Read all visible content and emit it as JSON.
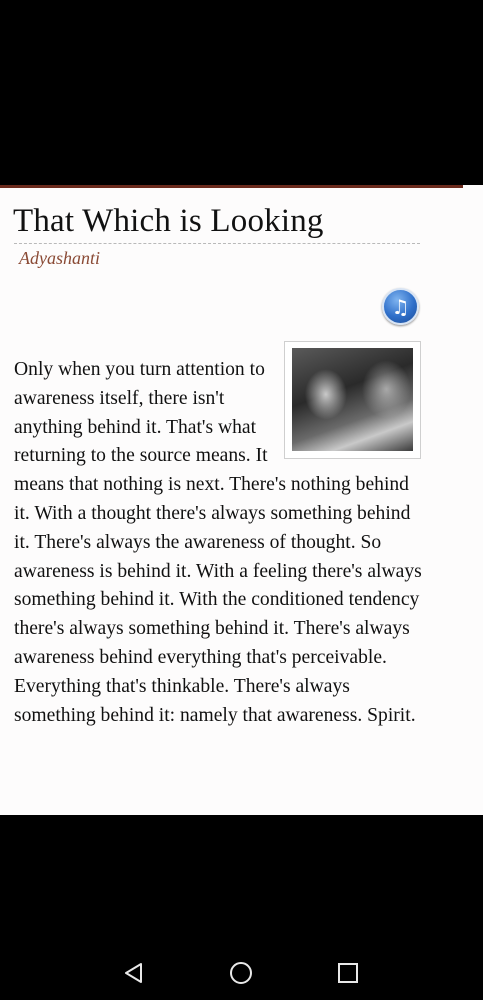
{
  "article": {
    "title": "That Which is Looking",
    "author": "Adyashanti",
    "body": "Only when you turn attention to awareness itself, there isn't anything behind it. That's what returning to the source means. It means that nothing is next. There's nothing behind it. With a thought there's always something behind it. There's always the awareness of thought. So awareness is behind it. With a feeling there's always something behind it. With the conditioned tendency there's always something behind it. There's always awareness behind everything that's perceivable. Everything that's thinkable. There's always something behind it: namely that awareness. Spirit.",
    "audio_icon": "music-note-icon",
    "accent_color": "#6b2a1c",
    "author_color": "#8a4a35"
  },
  "navigation": {
    "back_icon": "back-triangle-icon",
    "home_icon": "home-circle-icon",
    "recent_icon": "recent-square-icon"
  }
}
